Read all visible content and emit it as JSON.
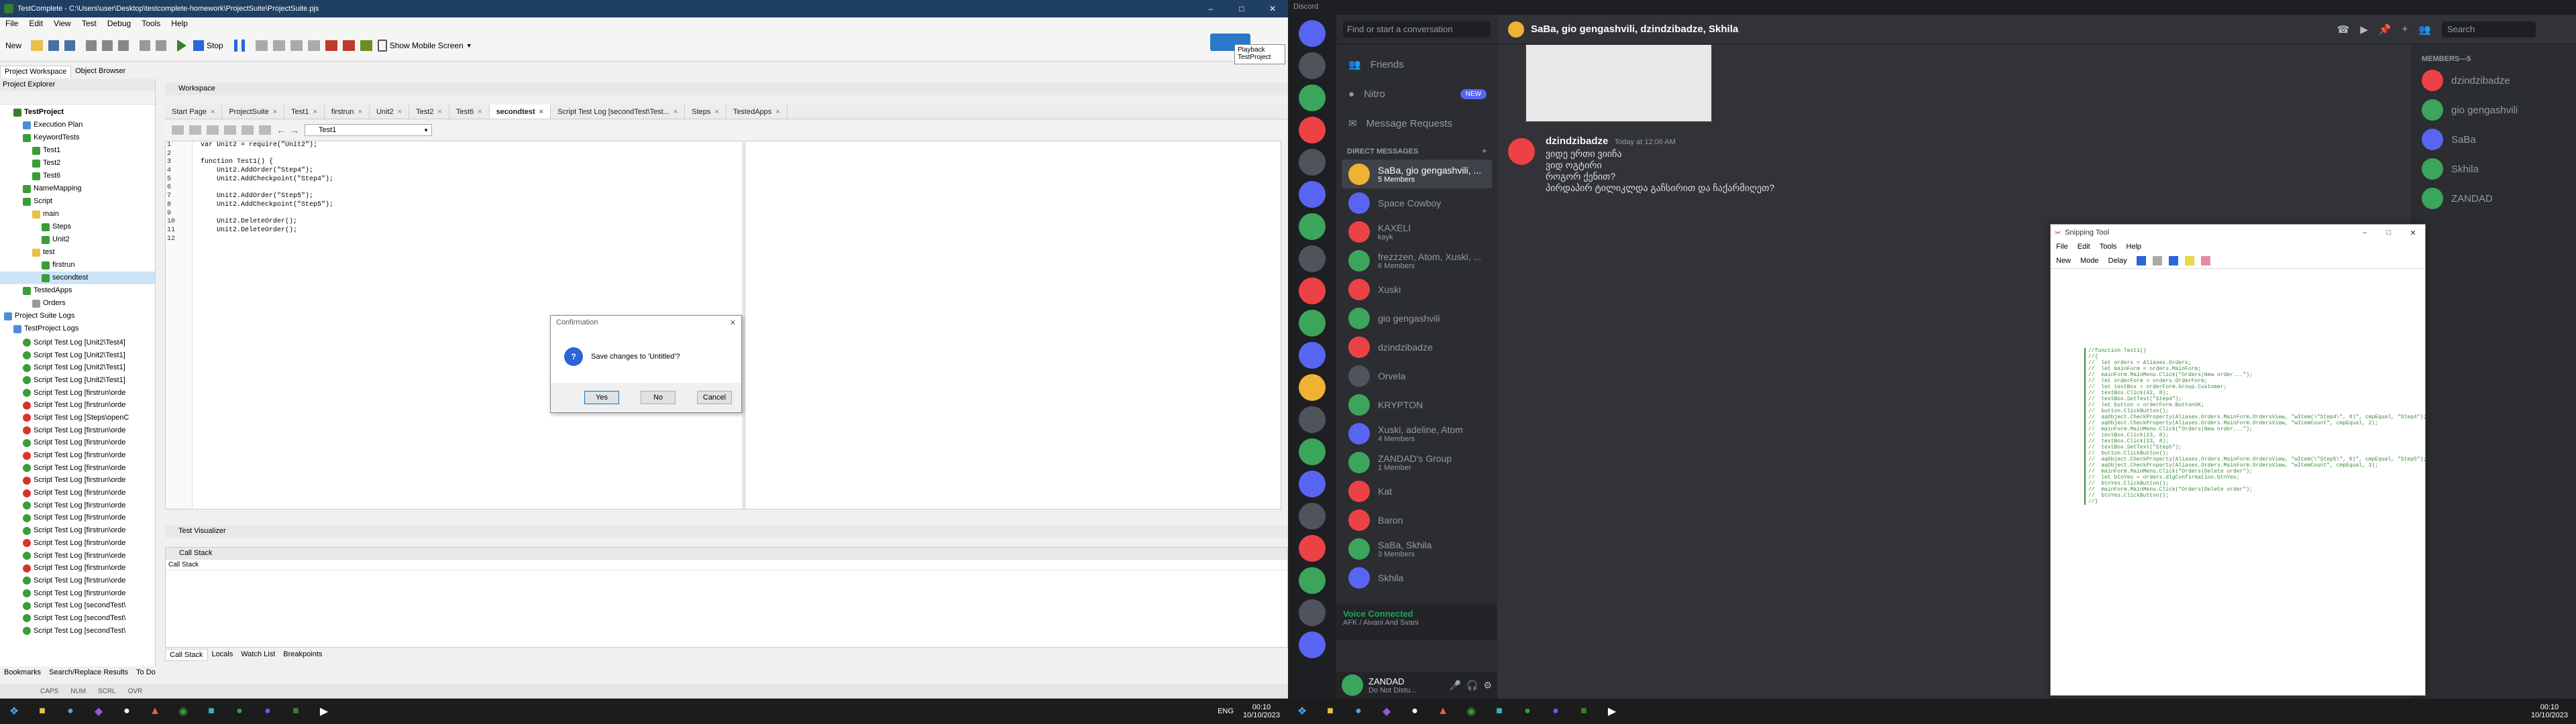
{
  "tc": {
    "title": "TestComplete - C:\\Users\\user\\Desktop\\testcomplete-homework\\ProjectSuite\\ProjectSuite.pjs",
    "menu": [
      "File",
      "Edit",
      "View",
      "Test",
      "Debug",
      "Tools",
      "Help"
    ],
    "toolbar": {
      "new": "New",
      "stop": "Stop",
      "mobile": "Show Mobile Screen",
      "playback": "Playback",
      "project": "TestProject"
    },
    "panel_tabs": [
      "Project Workspace",
      "Object Browser"
    ],
    "explorer_title": "Project Explorer",
    "workspace_title": "Workspace",
    "tree": [
      {
        "label": "TestProject",
        "lvl": 1,
        "color": "#3a7d2c",
        "bold": true
      },
      {
        "label": "Execution Plan",
        "lvl": 2,
        "color": "#4a90d9"
      },
      {
        "label": "KeywordTests",
        "lvl": 2,
        "color": "#3a9d3a"
      },
      {
        "label": "Test1",
        "lvl": 3,
        "color": "#3a9d3a"
      },
      {
        "label": "Test2",
        "lvl": 3,
        "color": "#3a9d3a"
      },
      {
        "label": "Test6",
        "lvl": 3,
        "color": "#3a9d3a"
      },
      {
        "label": "NameMapping",
        "lvl": 2,
        "color": "#3a9d3a"
      },
      {
        "label": "Script",
        "lvl": 2,
        "color": "#3a9d3a"
      },
      {
        "label": "main",
        "lvl": 3,
        "color": "#e8c04a"
      },
      {
        "label": "Steps",
        "lvl": 4,
        "color": "#3a9d3a"
      },
      {
        "label": "Unit2",
        "lvl": 4,
        "color": "#3a9d3a"
      },
      {
        "label": "test",
        "lvl": 3,
        "color": "#e8c04a"
      },
      {
        "label": "firstrun",
        "lvl": 4,
        "color": "#3a9d3a"
      },
      {
        "label": "secondtest",
        "lvl": 4,
        "color": "#3a9d3a",
        "sel": true
      },
      {
        "label": "TestedApps",
        "lvl": 2,
        "color": "#3a9d3a"
      },
      {
        "label": "Orders",
        "lvl": 3,
        "color": "#999"
      },
      {
        "label": "Project Suite Logs",
        "lvl": 0,
        "color": "#4a90d9"
      },
      {
        "label": "TestProject Logs",
        "lvl": 1,
        "color": "#4a90d9"
      }
    ],
    "logs": [
      {
        "label": "Script Test Log [Unit2\\Test4]",
        "ok": true
      },
      {
        "label": "Script Test Log [Unit2\\Test1]",
        "ok": true
      },
      {
        "label": "Script Test Log [Unit2\\Test1]",
        "ok": true
      },
      {
        "label": "Script Test Log [Unit2\\Test1]",
        "ok": true
      },
      {
        "label": "Script Test Log [firstrun\\orde",
        "ok": true
      },
      {
        "label": "Script Test Log [firstrun\\orde",
        "ok": false
      },
      {
        "label": "Script Test Log [Steps\\openC",
        "ok": false
      },
      {
        "label": "Script Test Log [firstrun\\orde",
        "ok": false
      },
      {
        "label": "Script Test Log [firstrun\\orde",
        "ok": true
      },
      {
        "label": "Script Test Log [firstrun\\orde",
        "ok": false
      },
      {
        "label": "Script Test Log [firstrun\\orde",
        "ok": true
      },
      {
        "label": "Script Test Log [firstrun\\orde",
        "ok": false
      },
      {
        "label": "Script Test Log [firstrun\\orde",
        "ok": false
      },
      {
        "label": "Script Test Log [firstrun\\orde",
        "ok": true
      },
      {
        "label": "Script Test Log [firstrun\\orde",
        "ok": true
      },
      {
        "label": "Script Test Log [firstrun\\orde",
        "ok": true
      },
      {
        "label": "Script Test Log [firstrun\\orde",
        "ok": false
      },
      {
        "label": "Script Test Log [firstrun\\orde",
        "ok": true
      },
      {
        "label": "Script Test Log [firstrun\\orde",
        "ok": false
      },
      {
        "label": "Script Test Log [firstrun\\orde",
        "ok": true
      },
      {
        "label": "Script Test Log [firstrun\\orde",
        "ok": true
      },
      {
        "label": "Script Test Log [secondTest\\",
        "ok": true
      },
      {
        "label": "Script Test Log [secondTest\\",
        "ok": true
      },
      {
        "label": "Script Test Log [secondTest\\",
        "ok": true
      }
    ],
    "bottom_left_tabs": [
      "Bookmarks",
      "Search/Replace Results",
      "To Do"
    ],
    "status": [
      "CAPS",
      "NUM",
      "SCRL",
      "OVR"
    ],
    "doc_tabs": [
      "Start Page",
      "ProjectSuite",
      "Test1",
      "firstrun",
      "Unit2",
      "Test2",
      "Test6",
      "secondtest",
      "Script Test Log [secondTest\\Test...",
      "Steps",
      "TestedApps"
    ],
    "editor_combo": "Test1",
    "code_lines": [
      "var Unit2 = require(\"Unit2\");",
      "",
      "function Test1() {",
      "    Unit2.AddOrder(\"Step4\");",
      "    Unit2.AddCheckpoint(\"Step4\");",
      "",
      "    Unit2.AddOrder(\"Step5\");",
      "    Unit2.AddCheckpoint(\"Step5\");",
      "",
      "    Unit2.DeleteOrder();",
      "    Unit2.DeleteOrder();",
      ""
    ],
    "dialog": {
      "title": "Confirmation",
      "message": "Save changes to 'Untitled'?",
      "yes": "Yes",
      "no": "No",
      "cancel": "Cancel"
    },
    "test_visualizer": "Test Visualizer",
    "call_stack_title": "Call Stack",
    "call_stack_col": "Call Stack",
    "bottom_tabs": [
      "Call Stack",
      "Locals",
      "Watch List",
      "Breakpoints"
    ]
  },
  "taskbar": {
    "lang": "ENG",
    "time": "00:10",
    "date": "10/10/2023"
  },
  "discord": {
    "title": "Discord",
    "search": "Find or start a conversation",
    "nav": [
      "Friends",
      "Nitro",
      "Message Requests"
    ],
    "new_badge": "NEW",
    "dm_header": "DIRECT MESSAGES",
    "dms": [
      {
        "name": "SaBa, gio gengashvili, ...",
        "sub": "5 Members",
        "color": "#f0b232",
        "active": true
      },
      {
        "name": "Space Cowboy",
        "sub": "",
        "color": "#5865f2"
      },
      {
        "name": "KAXELI",
        "sub": "kayk",
        "color": "#ed4245"
      },
      {
        "name": "frezzzen, Atom, Xuski, ...",
        "sub": "6 Members",
        "color": "#3ba55c"
      },
      {
        "name": "Xuski",
        "sub": "",
        "color": "#ed4245"
      },
      {
        "name": "gio gengashvili",
        "sub": "",
        "color": "#3ba55c"
      },
      {
        "name": "dzindzibadze",
        "sub": "",
        "color": "#ed4245"
      },
      {
        "name": "Orvela",
        "sub": "",
        "color": "#4f545c"
      },
      {
        "name": "KRYPTON",
        "sub": "",
        "color": "#3ba55c"
      },
      {
        "name": "Xuski, adeline, Atom",
        "sub": "4 Members",
        "color": "#5865f2"
      },
      {
        "name": "ZANDAD's Group",
        "sub": "1 Member",
        "color": "#3ba55c"
      },
      {
        "name": "Kat",
        "sub": "",
        "color": "#ed4245"
      },
      {
        "name": "Baron",
        "sub": "",
        "color": "#ed4245"
      },
      {
        "name": "SaBa, Skhila",
        "sub": "3 Members",
        "color": "#3ba55c"
      },
      {
        "name": "Skhila",
        "sub": "",
        "color": "#5865f2"
      }
    ],
    "voice": {
      "status": "Voice Connected",
      "channel": "AFK / Aivani And Svani"
    },
    "user": {
      "name": "ZANDAD",
      "status": "Do Not Distu..."
    },
    "channel_title": "SaBa, gio gengashvili, dzindzibadze, Skhila",
    "header_search": "Search",
    "message": {
      "author": "dzindzibadze",
      "time": "Today at 12:06 AM",
      "lines": [
        "ვიდე ერთი ვიიჩა",
        "ვიდ ოგტირი",
        "როგორ ქენით?",
        "პირდაპირ ტილიკლდა გაჩსირით და ჩაქარმიღეთ?"
      ]
    },
    "members_header": "MEMBERS—5",
    "members": [
      {
        "name": "dzindzibadze",
        "color": "#ed4245"
      },
      {
        "name": "gio gengashvili",
        "color": "#3ba55c"
      },
      {
        "name": "SaBa",
        "color": "#5865f2"
      },
      {
        "name": "Skhila",
        "color": "#3ba55c"
      },
      {
        "name": "ZANDAD",
        "color": "#3ba55c"
      }
    ]
  },
  "snip": {
    "title": "Snipping Tool",
    "menu": [
      "File",
      "Edit",
      "Tools",
      "Help"
    ],
    "new": "New",
    "mode": "Mode",
    "delay": "Delay",
    "code": [
      "//function Test1()",
      "//{",
      "//  let orders = Aliases.Orders;",
      "//  let mainForm = orders.MainForm;",
      "//  mainForm.MainMenu.Click(\"Orders|New order...\");",
      "//  let orderForm = orders.OrderForm;",
      "//  let textBox = orderForm.Group.Customer;",
      "//  textBox.Click(42, 8);",
      "//  textBox.SetText(\"Step4\");",
      "//  let button = orderForm.ButtonOK;",
      "//  button.ClickButton();",
      "//  aqObject.CheckProperty(Aliases.Orders.MainForm.OrdersView, \"wItem(\\\"Step4\\\", 0)\", cmpEqual, \"Step4\");",
      "//  aqObject.CheckProperty(Aliases.Orders.MainForm.OrdersView, \"wItemCount\", cmpEqual, 2);",
      "//  mainForm.MainMenu.Click(\"Orders|New order...\");",
      "//  textBox.Click(23, 8);",
      "//  textBox.Click(23, 8);",
      "//  textBox.SetText(\"Step5\");",
      "//  button.ClickButton();",
      "//  aqObject.CheckProperty(Aliases.Orders.MainForm.OrdersView, \"wItem(\\\"Step5\\\", 0)\", cmpEqual, \"Step5\");",
      "//  aqObject.CheckProperty(Aliases.Orders.MainForm.OrdersView, \"wItemCount\", cmpEqual, 3);",
      "//  mainForm.MainMenu.Click(\"Orders|Delete order\");",
      "//  let btnYes = orders.dlgConfirmation.btnYes;",
      "//  btnYes.ClickButton();",
      "//  mainForm.MainMenu.Click(\"Orders|Delete order\");",
      "//  btnYes.ClickButton();",
      "//}"
    ]
  }
}
